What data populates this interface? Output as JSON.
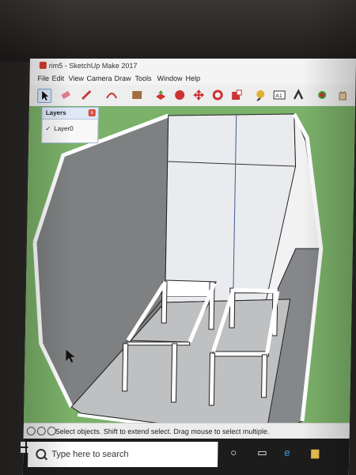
{
  "window": {
    "title": "rim5 - SketchUp Make 2017"
  },
  "menu": [
    "File",
    "Edit",
    "View",
    "Camera",
    "Draw",
    "Tools",
    "Window",
    "Help"
  ],
  "layers_panel": {
    "title": "Layers",
    "close": "x",
    "checkmark": "✓",
    "layer_name": "Layer0"
  },
  "status": {
    "message": "Select objects. Shift to extend select. Drag mouse to select multiple."
  },
  "taskbar": {
    "search_placeholder": "Type here to search"
  },
  "colors": {
    "viewport_bg": "#7bb169",
    "wall_dark": "#7f8081",
    "wall_light": "#eaebee",
    "floor": "#bfc0c2"
  }
}
